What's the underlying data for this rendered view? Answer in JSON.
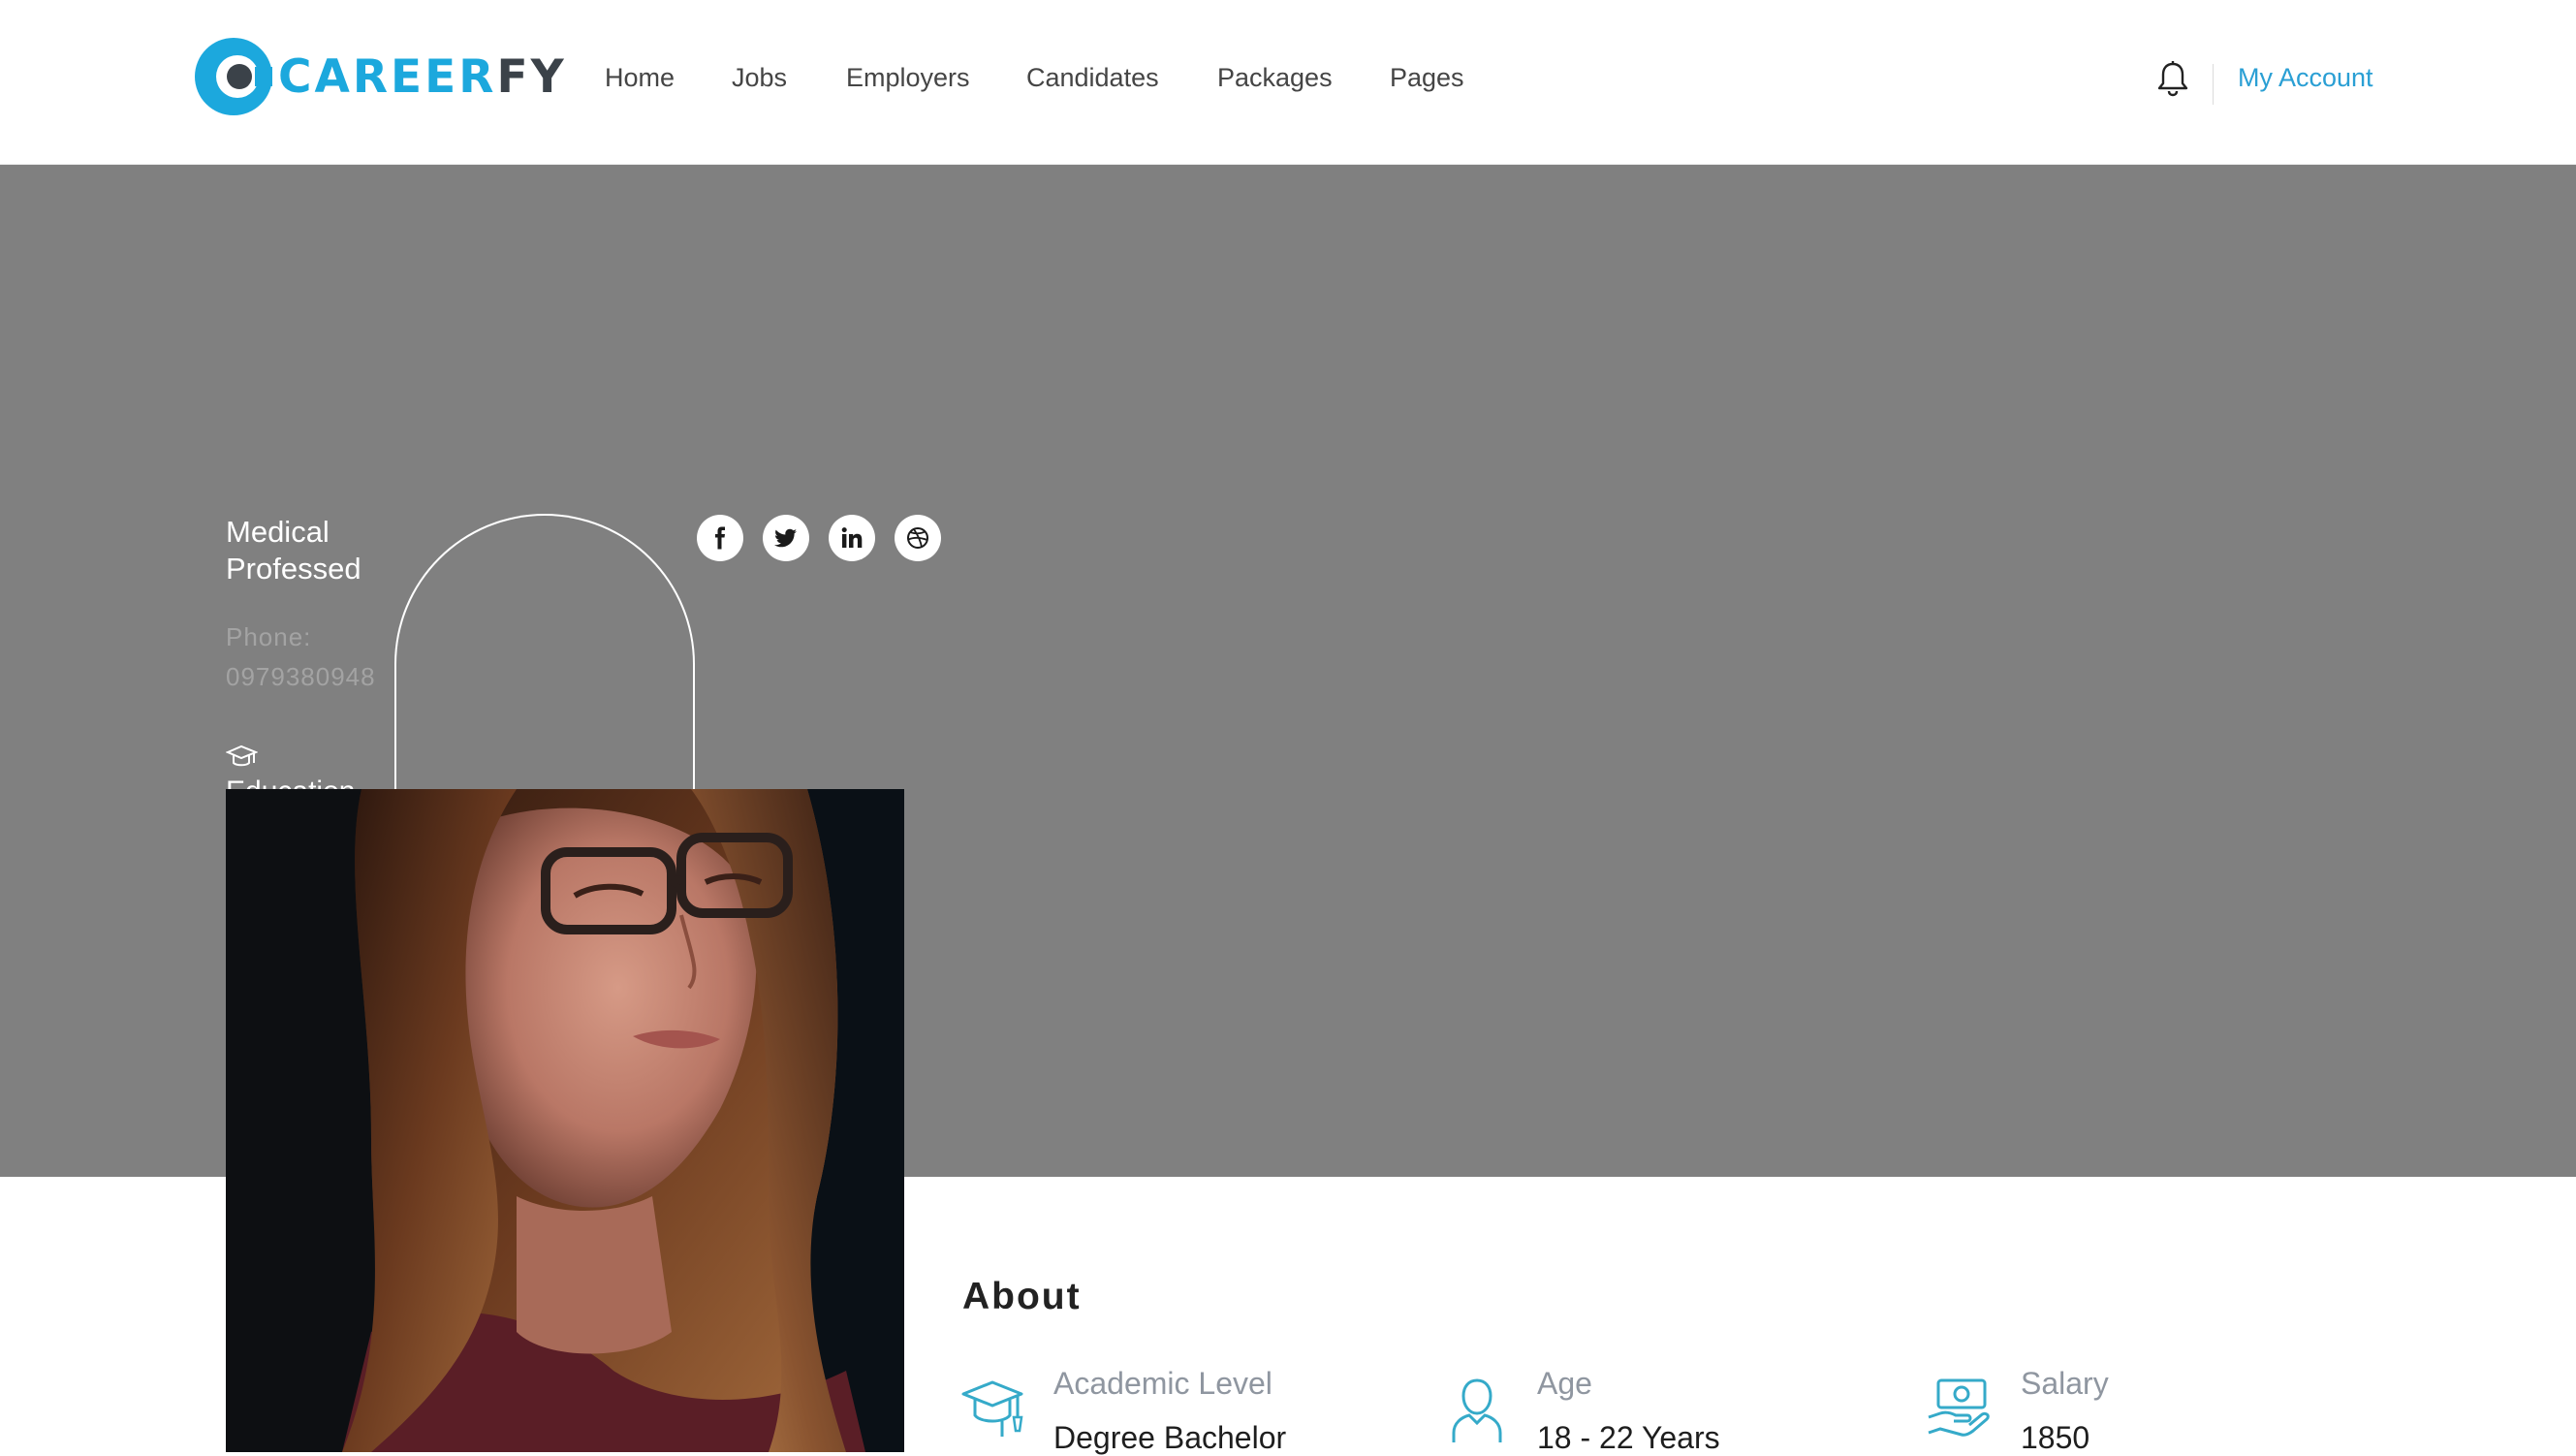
{
  "header": {
    "logo": {
      "text_a": "CAREER",
      "text_b": "FY"
    },
    "nav": [
      {
        "label": "Home"
      },
      {
        "label": "Jobs"
      },
      {
        "label": "Employers"
      },
      {
        "label": "Candidates"
      },
      {
        "label": "Packages"
      },
      {
        "label": "Pages"
      }
    ],
    "account_label": "My Account",
    "icons": {
      "notifications": "bell-icon"
    }
  },
  "candidate": {
    "title": "Medical Professed",
    "phone": "Phone: 0979380948",
    "education_icon": "graduation-cap-icon",
    "education_label": "Education",
    "social": [
      {
        "name": "facebook",
        "icon": "facebook-icon"
      },
      {
        "name": "twitter",
        "icon": "twitter-icon"
      },
      {
        "name": "linkedin",
        "icon": "linkedin-icon"
      },
      {
        "name": "dribbble",
        "icon": "dribbble-icon"
      }
    ]
  },
  "about": {
    "title": "About",
    "items": [
      {
        "label": "Academic Level",
        "value": "Degree Bachelor",
        "icon": "graduation-cap-icon"
      },
      {
        "label": "Age",
        "value": "18 - 22 Years",
        "icon": "user-icon"
      },
      {
        "label": "Salary",
        "value": "1850",
        "icon": "salary-icon"
      }
    ]
  },
  "colors": {
    "brand": "#1ca8dd",
    "logo_dark": "#3b4249",
    "banner": "#808080",
    "link": "#2a9fd4",
    "icon_accent": "#35aac9"
  }
}
